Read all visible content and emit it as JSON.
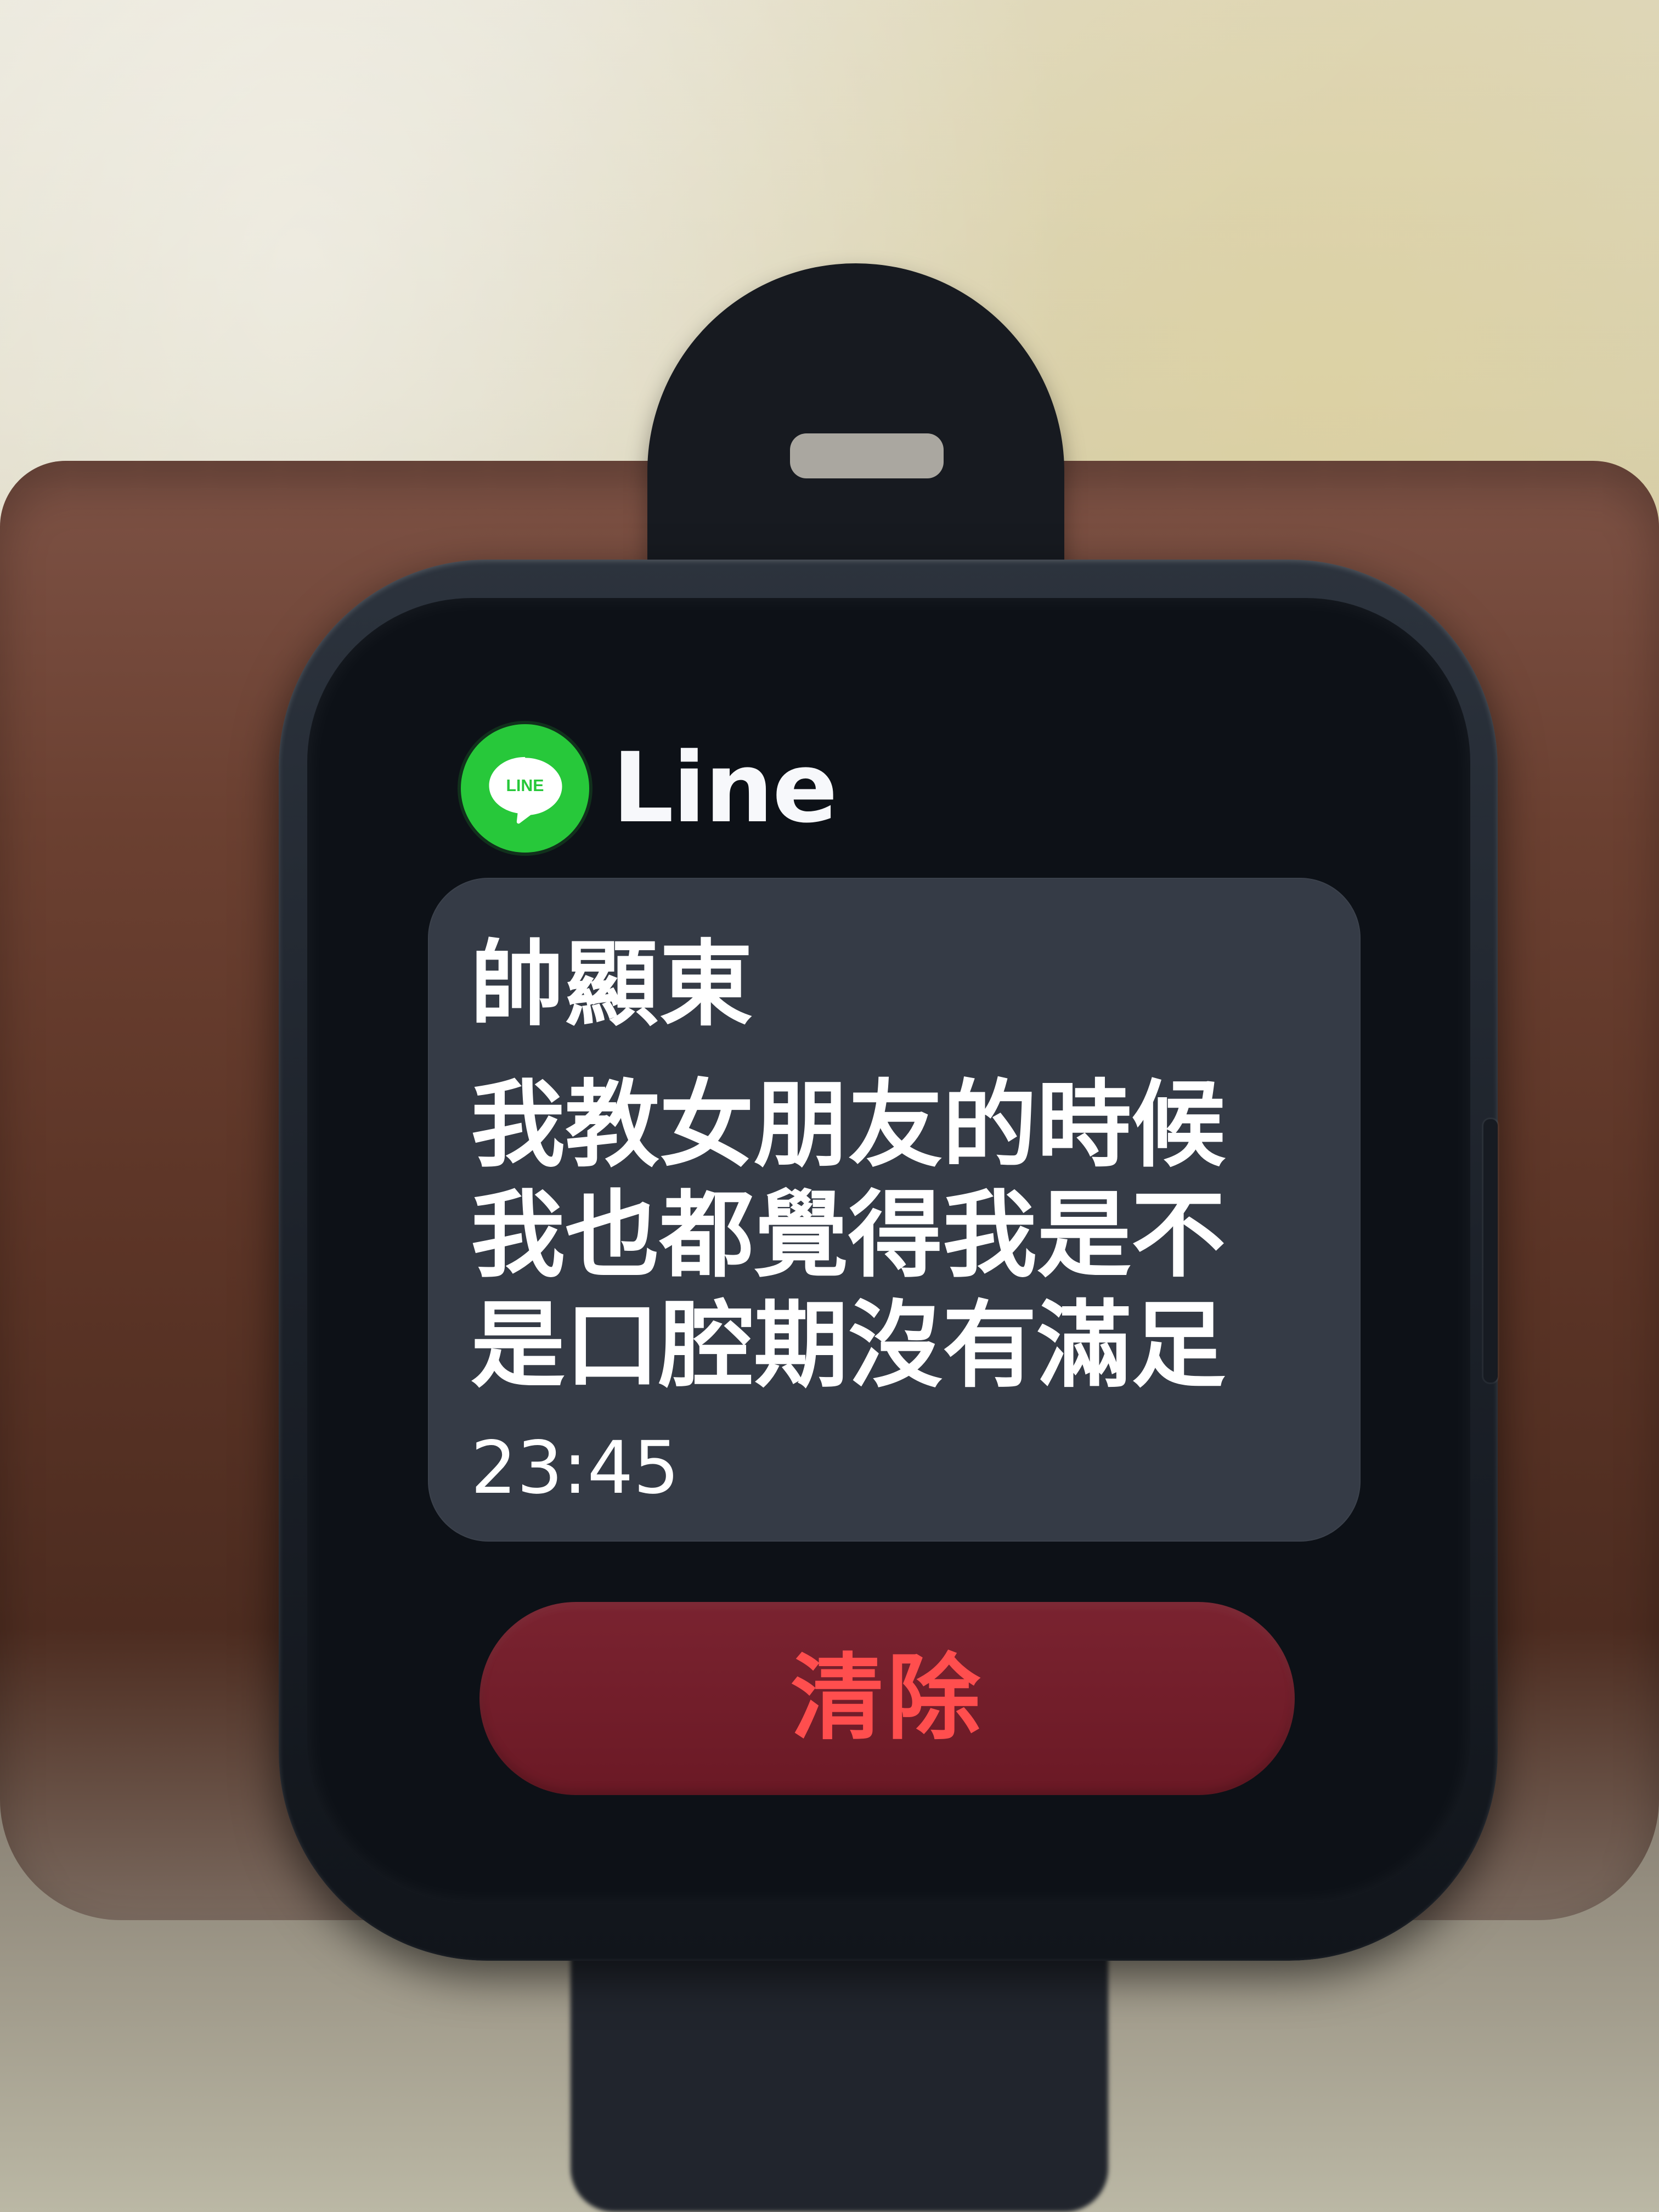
{
  "notification": {
    "app_name": "Line",
    "app_icon": "line-icon",
    "sender": "帥顯東",
    "message": "我教女朋友的時候我也都覺得我是不是口腔期沒有滿足",
    "time": "23:45"
  },
  "actions": {
    "clear_label": "清除"
  },
  "colors": {
    "line_green": "#27c83a",
    "clear_text_red": "#ff4e4e",
    "clear_bg": "#6b1925"
  }
}
